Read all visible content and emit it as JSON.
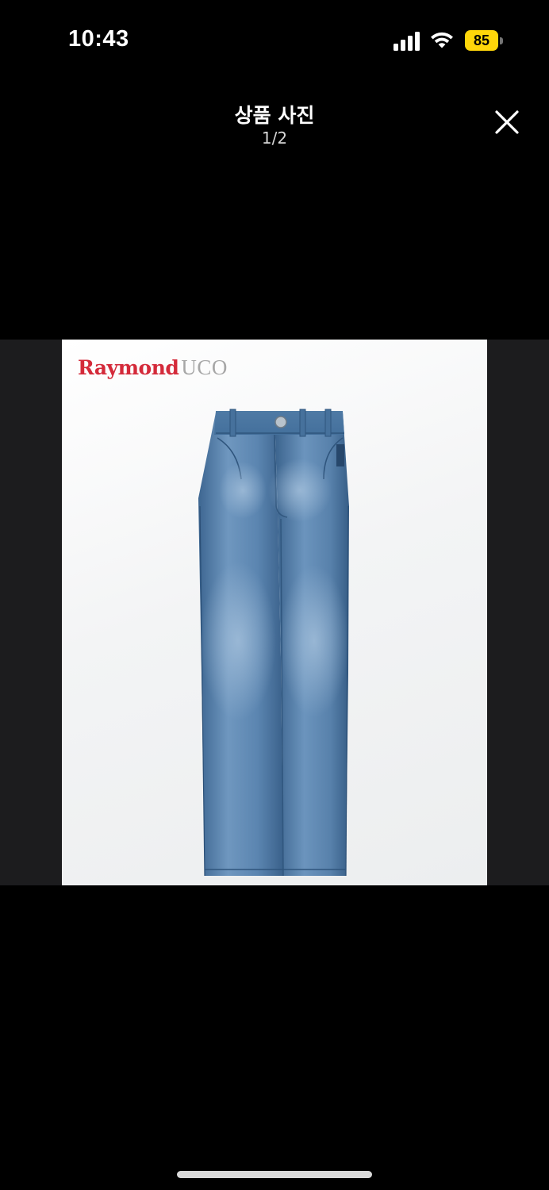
{
  "status_bar": {
    "time": "10:43",
    "battery_level": "85",
    "icons": [
      "signal-icon",
      "wifi-icon",
      "battery-icon"
    ]
  },
  "header": {
    "title": "상품 사진",
    "counter": "1/2",
    "close_icon": "close-icon"
  },
  "photo": {
    "brand_name": "Raymond",
    "brand_sub": "UCO"
  },
  "colors": {
    "background": "#000000",
    "viewer_band": "#1c1c1e",
    "battery": "#ffd60a",
    "brand_red": "#d42a3a",
    "denim": "#4d79a6"
  }
}
